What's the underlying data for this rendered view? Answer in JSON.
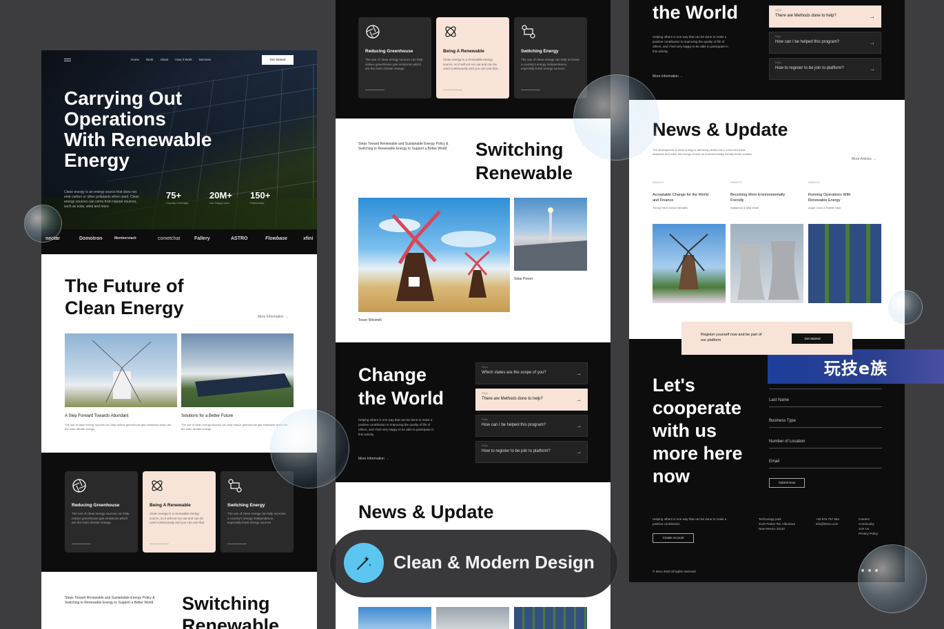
{
  "nav": {
    "items": [
      "Home",
      "Work",
      "About",
      "How It Work",
      "Services"
    ],
    "cta": "Get Started"
  },
  "hero": {
    "title_lines": [
      "Carrying Out",
      "Operations",
      "With Renewable",
      "Energy"
    ],
    "desc": "Clean energy is an energy source that does not emit carbon or other pollutants when used. Clean energy sources can come from natural sources, such as solar, wind and more",
    "stats": [
      {
        "value": "75+",
        "label": "Country Coverage"
      },
      {
        "value": "20M+",
        "label": "Our Happy User"
      },
      {
        "value": "150+",
        "label": "Partnership"
      }
    ]
  },
  "logos": [
    "nectar",
    "Domotron",
    "Memberstack",
    "cometchat",
    "Fallery",
    "ASTRO",
    "Flowbase",
    "xfini"
  ],
  "future": {
    "title_lines": [
      "The Future of",
      "Clean Energy"
    ],
    "more": "More Information →",
    "items": [
      {
        "title": "A Step Forward Towards Abundant",
        "desc": "The use of clean energy sources can help reduce greenhouse gas emissions which are the main climate change."
      },
      {
        "title": "Solutions for a Better Future",
        "desc": "The use of clean energy sources can help reduce greenhouse gas emissions which are the main climate change."
      }
    ]
  },
  "cards": [
    {
      "icon": "aperture-icon",
      "title": "Reducing Greenhouse",
      "desc": "The use of clean energy sources can help reduce greenhouse gas emissions which are the main climate change."
    },
    {
      "icon": "atom-icon",
      "title": "Being A Renewable",
      "desc": "Clean energy is a renewable energy source, so it will not run out and can be used continuously and you can use that."
    },
    {
      "icon": "switch-icon",
      "title": "Switching Energy",
      "desc": "The use of clean energy can help increase a country's energy independence, especially fossil energy sources."
    }
  ],
  "switching": {
    "intro": "Steps Toward Renewable and Sustainable Energy Policy & Switching to Renewable Energy to Support a Better World",
    "title_lines": [
      "Switching",
      "Renewable"
    ],
    "captions": [
      "Tower Windmill",
      "Solar Power"
    ]
  },
  "change": {
    "title_lines": [
      "Change",
      "the World"
    ],
    "desc": "Helping others is one way that can be done to make a positive contribution to improving the quality of life of others, and I feel very happy to be able to participate in this activity.",
    "more": "More Information →",
    "faq_label": "FAQs",
    "faqs": [
      "Which states are the scope of you?",
      "There are Methods done to help?",
      "How can I be helped this program?",
      "How to register to be join to platform?"
    ]
  },
  "news": {
    "title": "News & Update",
    "desc": "The development of clean energy is still being carried out to overcome these obstacles and make this energy source an environmentally friendly future solution",
    "more": "More Articles →",
    "tag": "INSIGHTS",
    "items": [
      {
        "title": "Acceptable Change for the World and Finance",
        "authors": "Timoty Hill & Gerard Morales"
      },
      {
        "title": "Becoming More Environmentally Friendly",
        "authors": "Sakamoto & Mila Ewoll"
      },
      {
        "title": "Running Operations With Renewable Energy",
        "authors": "Angel Chen & Shellie Nolo"
      }
    ]
  },
  "register": {
    "text": "Register yourself now and be part of our platform",
    "cta": "Get Started"
  },
  "cooperate": {
    "title_lines": [
      "Let's",
      "cooperate",
      "with us",
      "more here",
      "now"
    ],
    "fields": [
      "Last Name",
      "Business Type",
      "Number of Location",
      "Email"
    ],
    "submit": "Submit Now"
  },
  "footer": {
    "desc": "Helping others is one way that can be done to make a positive contribution",
    "create": "Create Account",
    "address": [
      "Technology park",
      "4140 Parker Rd. Allentown",
      "New Mexico 31134"
    ],
    "contact": [
      "+62 876 767 654",
      "info@Deno.com"
    ],
    "links": [
      "Careers",
      "Community",
      "Join Us",
      "Privacy Policy"
    ],
    "copyright": "© deno 2023 all rights reserved"
  },
  "badge": {
    "text": "Clean & Modern Design",
    "icon": "magic-wand-icon"
  },
  "watermark": "玩技e族",
  "colors": {
    "bg": "#3d3d3f",
    "dark": "#0d0d0d",
    "card": "#2a2a2a",
    "pink": "#f7e3d8",
    "badge_icon": "#5cc6f0"
  }
}
